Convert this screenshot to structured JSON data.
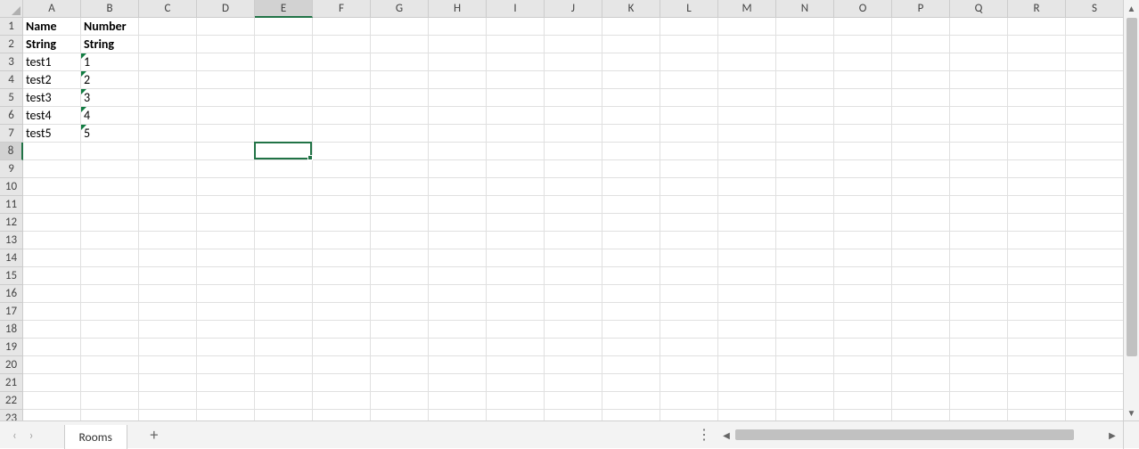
{
  "columns": [
    "A",
    "B",
    "C",
    "D",
    "E",
    "F",
    "G",
    "H",
    "I",
    "J",
    "K",
    "L",
    "M",
    "N",
    "O",
    "P",
    "Q",
    "R",
    "S"
  ],
  "row_count": 23,
  "active_cell": {
    "col_index": 4,
    "row_index": 7
  },
  "cells": {
    "r1": {
      "A": {
        "v": "Name",
        "bold": true
      },
      "B": {
        "v": "Number",
        "bold": true
      }
    },
    "r2": {
      "A": {
        "v": "String",
        "bold": true
      },
      "B": {
        "v": "String",
        "bold": true
      }
    },
    "r3": {
      "A": {
        "v": "test1"
      },
      "B": {
        "v": "1",
        "tri": true
      }
    },
    "r4": {
      "A": {
        "v": "test2"
      },
      "B": {
        "v": "2",
        "tri": true
      }
    },
    "r5": {
      "A": {
        "v": "test3"
      },
      "B": {
        "v": "3",
        "tri": true
      }
    },
    "r6": {
      "A": {
        "v": "test4"
      },
      "B": {
        "v": "4",
        "tri": true
      }
    },
    "r7": {
      "A": {
        "v": "test5"
      },
      "B": {
        "v": "5",
        "tri": true
      }
    }
  },
  "sheets": {
    "active": "Rooms"
  },
  "icons": {
    "prev": "‹",
    "next": "›",
    "add": "+",
    "dots": "⋮",
    "up": "▲",
    "down": "▼",
    "left": "◀",
    "right": "▶"
  }
}
